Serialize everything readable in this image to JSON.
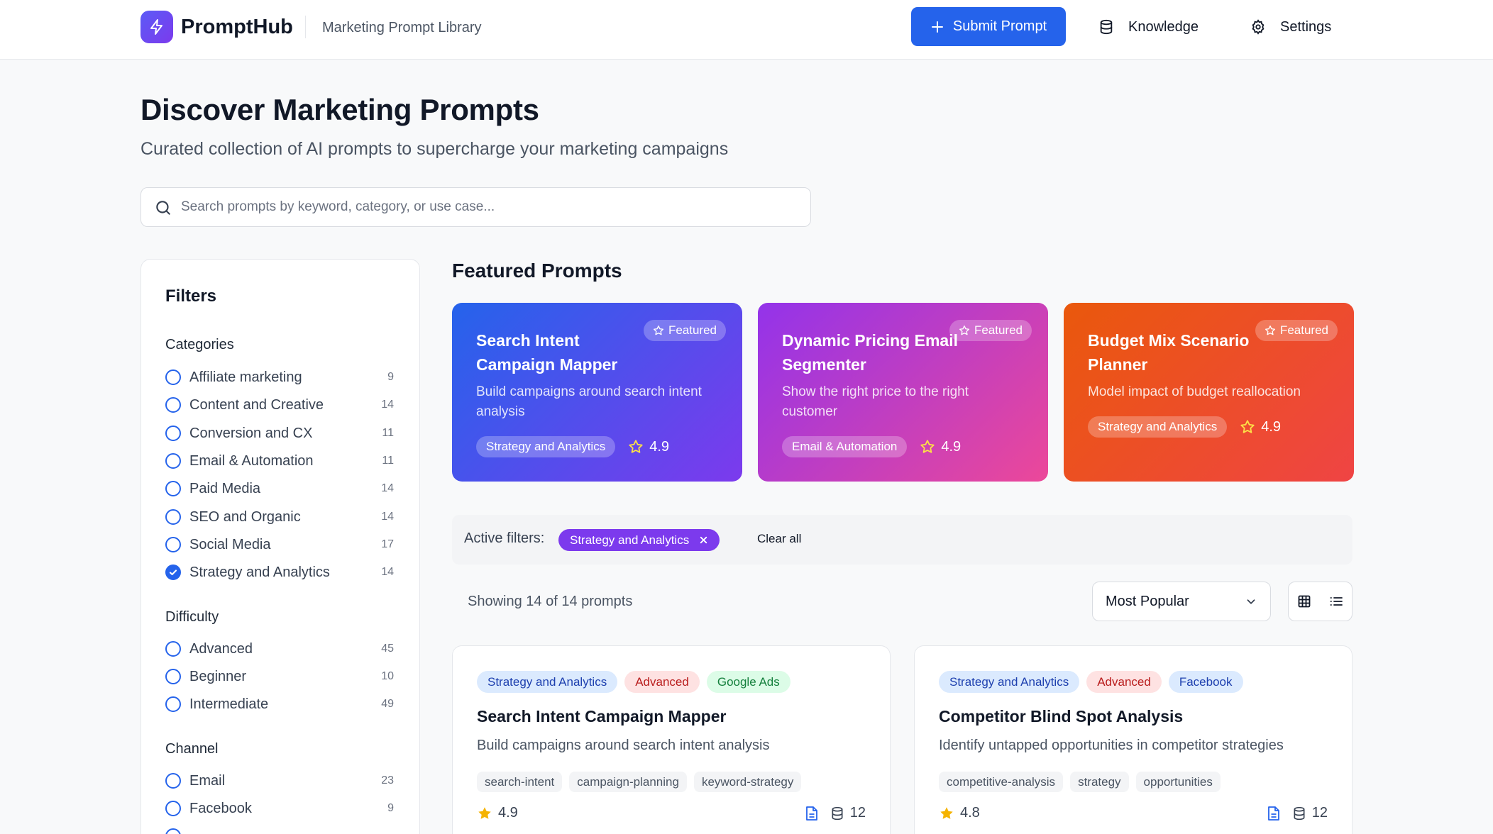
{
  "header": {
    "brand": "PromptHub",
    "subtitle": "Marketing Prompt Library",
    "submit_label": "Submit Prompt",
    "knowledge_label": "Knowledge",
    "settings_label": "Settings"
  },
  "hero": {
    "title": "Discover Marketing Prompts",
    "subtitle": "Curated collection of AI prompts to supercharge your marketing campaigns",
    "search_placeholder": "Search prompts by keyword, category, or use case..."
  },
  "filters": {
    "title": "Filters",
    "categories_label": "Categories",
    "categories": [
      {
        "label": "Affiliate marketing",
        "count": "9",
        "checked": false
      },
      {
        "label": "Content and Creative",
        "count": "14",
        "checked": false
      },
      {
        "label": "Conversion and CX",
        "count": "11",
        "checked": false
      },
      {
        "label": "Email & Automation",
        "count": "11",
        "checked": false
      },
      {
        "label": "Paid Media",
        "count": "14",
        "checked": false
      },
      {
        "label": "SEO and Organic",
        "count": "14",
        "checked": false
      },
      {
        "label": "Social Media",
        "count": "17",
        "checked": false
      },
      {
        "label": "Strategy and Analytics",
        "count": "14",
        "checked": true
      }
    ],
    "difficulty_label": "Difficulty",
    "difficulty": [
      {
        "label": "Advanced",
        "count": "45"
      },
      {
        "label": "Beginner",
        "count": "10"
      },
      {
        "label": "Intermediate",
        "count": "49"
      }
    ],
    "channel_label": "Channel",
    "channel": [
      {
        "label": "Email",
        "count": "23"
      },
      {
        "label": "Facebook",
        "count": "9"
      }
    ]
  },
  "featured": {
    "title": "Featured Prompts",
    "badge": "Featured",
    "cards": [
      {
        "title": "Search Intent Campaign Mapper",
        "desc": "Build campaigns around search intent analysis",
        "tag": "Strategy and Analytics",
        "rating": "4.9"
      },
      {
        "title": "Dynamic Pricing Email Segmenter",
        "desc": "Show the right price to the right customer",
        "tag": "Email & Automation",
        "rating": "4.9"
      },
      {
        "title": "Budget Mix Scenario Planner",
        "desc": "Model impact of budget reallocation",
        "tag": "Strategy and Analytics",
        "rating": "4.9"
      }
    ]
  },
  "active_filters": {
    "label": "Active filters:",
    "chip": "Strategy and Analytics",
    "clear": "Clear all"
  },
  "results": {
    "showing": "Showing 14 of 14 prompts",
    "sort": "Most Popular"
  },
  "cards": [
    {
      "tags": [
        "Strategy and Analytics",
        "Advanced",
        "Google Ads"
      ],
      "title": "Search Intent Campaign Mapper",
      "desc": "Build campaigns around search intent analysis",
      "keywords": [
        "search-intent",
        "campaign-planning",
        "keyword-strategy"
      ],
      "rating": "4.9",
      "uses": "12"
    },
    {
      "tags": [
        "Strategy and Analytics",
        "Advanced",
        "Facebook"
      ],
      "title": "Competitor Blind Spot Analysis",
      "desc": "Identify untapped opportunities in competitor strategies",
      "keywords": [
        "competitive-analysis",
        "strategy",
        "opportunities"
      ],
      "rating": "4.8",
      "uses": "12"
    }
  ],
  "colors": {
    "primary": "#2563eb",
    "accent": "#7c3aed",
    "star": "#f5b301"
  }
}
